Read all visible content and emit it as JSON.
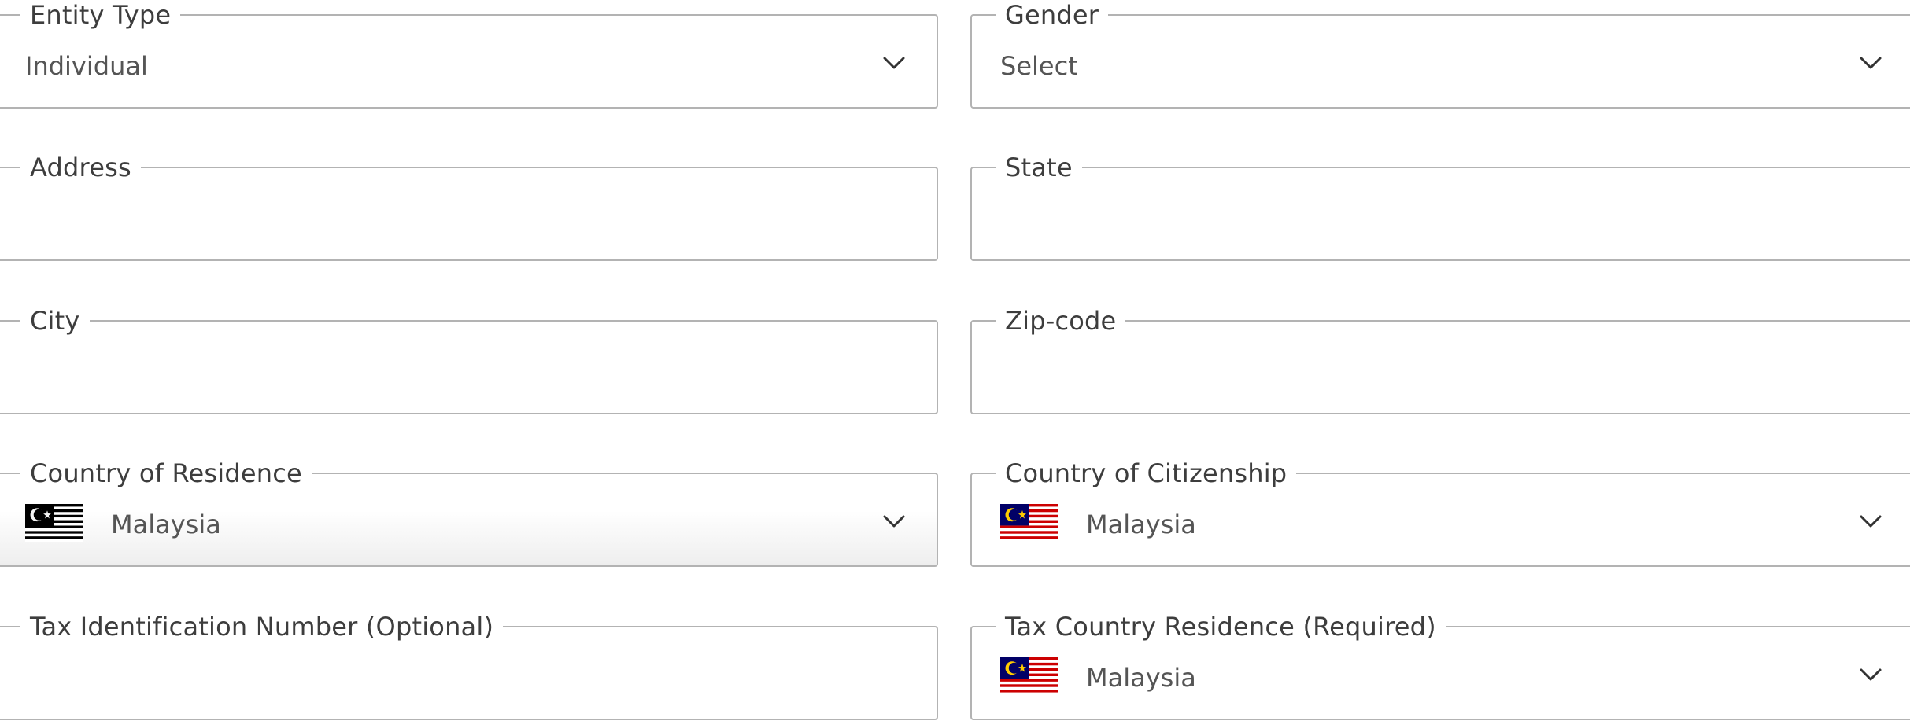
{
  "form": {
    "entity_type": {
      "label": "Entity Type",
      "value": "Individual"
    },
    "gender": {
      "label": "Gender",
      "value": "Select"
    },
    "address": {
      "label": "Address",
      "value": ""
    },
    "state": {
      "label": "State",
      "value": ""
    },
    "city": {
      "label": "City",
      "value": ""
    },
    "zip_code": {
      "label": "Zip-code",
      "value": ""
    },
    "country_of_residence": {
      "label": "Country of Residence",
      "value": "Malaysia",
      "flag_icon": "malaysia-flag-icon"
    },
    "country_of_citizenship": {
      "label": "Country of Citizenship",
      "value": "Malaysia",
      "flag_icon": "malaysia-flag-icon"
    },
    "tax_identification_number": {
      "label": "Tax Identification Number (Optional)",
      "value": ""
    },
    "tax_country_residence": {
      "label": "Tax Country Residence (Required)",
      "value": "Malaysia",
      "flag_icon": "malaysia-flag-icon"
    }
  },
  "icons": {
    "dropdown": "chevron-down-icon"
  },
  "colors": {
    "border": "#b3b3b3",
    "text": "#555555",
    "flag_red": "#cc0001",
    "flag_blue": "#010066",
    "flag_yellow": "#ffcc00"
  }
}
